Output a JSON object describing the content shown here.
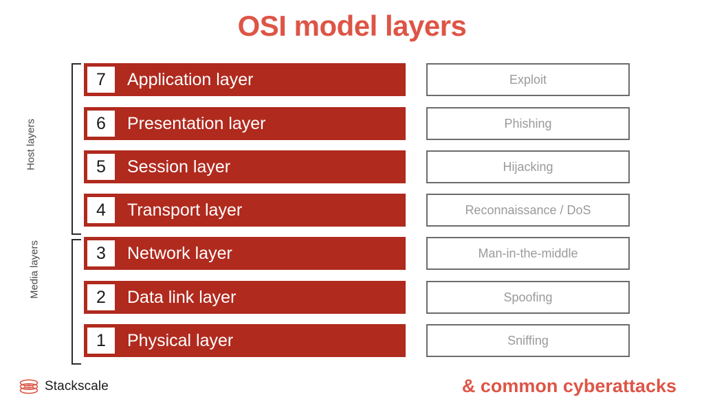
{
  "title": "OSI model layers",
  "colors": {
    "title_red": "#DD5546",
    "bar_red": "#B02A1E",
    "box_border_gray": "#6B6B6B",
    "box_text_gray": "#9A9A9A",
    "bracket_black": "#2b2b2b"
  },
  "groups": {
    "host": "Host layers",
    "media": "Media layers"
  },
  "layers": [
    {
      "number": "7",
      "name": "Application layer",
      "attack": "Exploit",
      "group": "host"
    },
    {
      "number": "6",
      "name": "Presentation layer",
      "attack": "Phishing",
      "group": "host"
    },
    {
      "number": "5",
      "name": "Session layer",
      "attack": "Hijacking",
      "group": "host"
    },
    {
      "number": "4",
      "name": "Transport layer",
      "attack": "Reconnaissance / DoS",
      "group": "host"
    },
    {
      "number": "3",
      "name": "Network layer",
      "attack": "Man-in-the-middle",
      "group": "media"
    },
    {
      "number": "2",
      "name": "Data link layer",
      "attack": "Spoofing",
      "group": "media"
    },
    {
      "number": "1",
      "name": "Physical layer",
      "attack": "Sniffing",
      "group": "media"
    }
  ],
  "footer": {
    "brand": "Stackscale",
    "logo_icon": "stacked-layers-icon",
    "tagline": "& common cyberattacks"
  }
}
